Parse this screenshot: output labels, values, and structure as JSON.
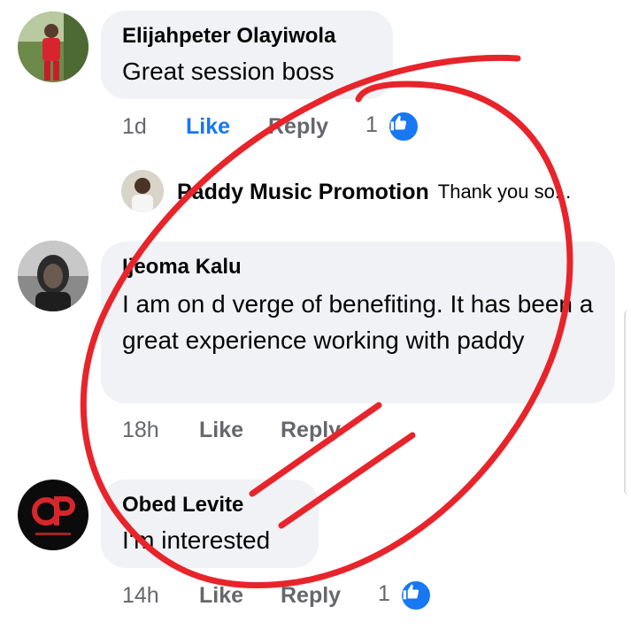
{
  "comments": [
    {
      "author": "Elijahpeter Olayiwola",
      "text": "Great session boss",
      "time": "1d",
      "like_label": "Like",
      "reply_label": "Reply",
      "like_count": "1"
    },
    {
      "author": "Ijeoma Kalu",
      "text": "I am on d verge of benefiting. It has been a great experience working with paddy",
      "time": "18h",
      "like_label": "Like",
      "reply_label": "Reply"
    },
    {
      "author": "Obed Levite",
      "text": "I'm interested",
      "time": "14h",
      "like_label": "Like",
      "reply_label": "Reply",
      "like_count": "1"
    }
  ],
  "reply_preview": {
    "author": "Paddy Music Promotion",
    "text": "Thank you so..."
  },
  "icons": {
    "like_reaction": "thumbs-up-icon"
  },
  "colors": {
    "bubble": "#f0f2f5",
    "like_active": "#1877f2",
    "meta_text": "#65676b",
    "annotation": "#e8242b"
  }
}
